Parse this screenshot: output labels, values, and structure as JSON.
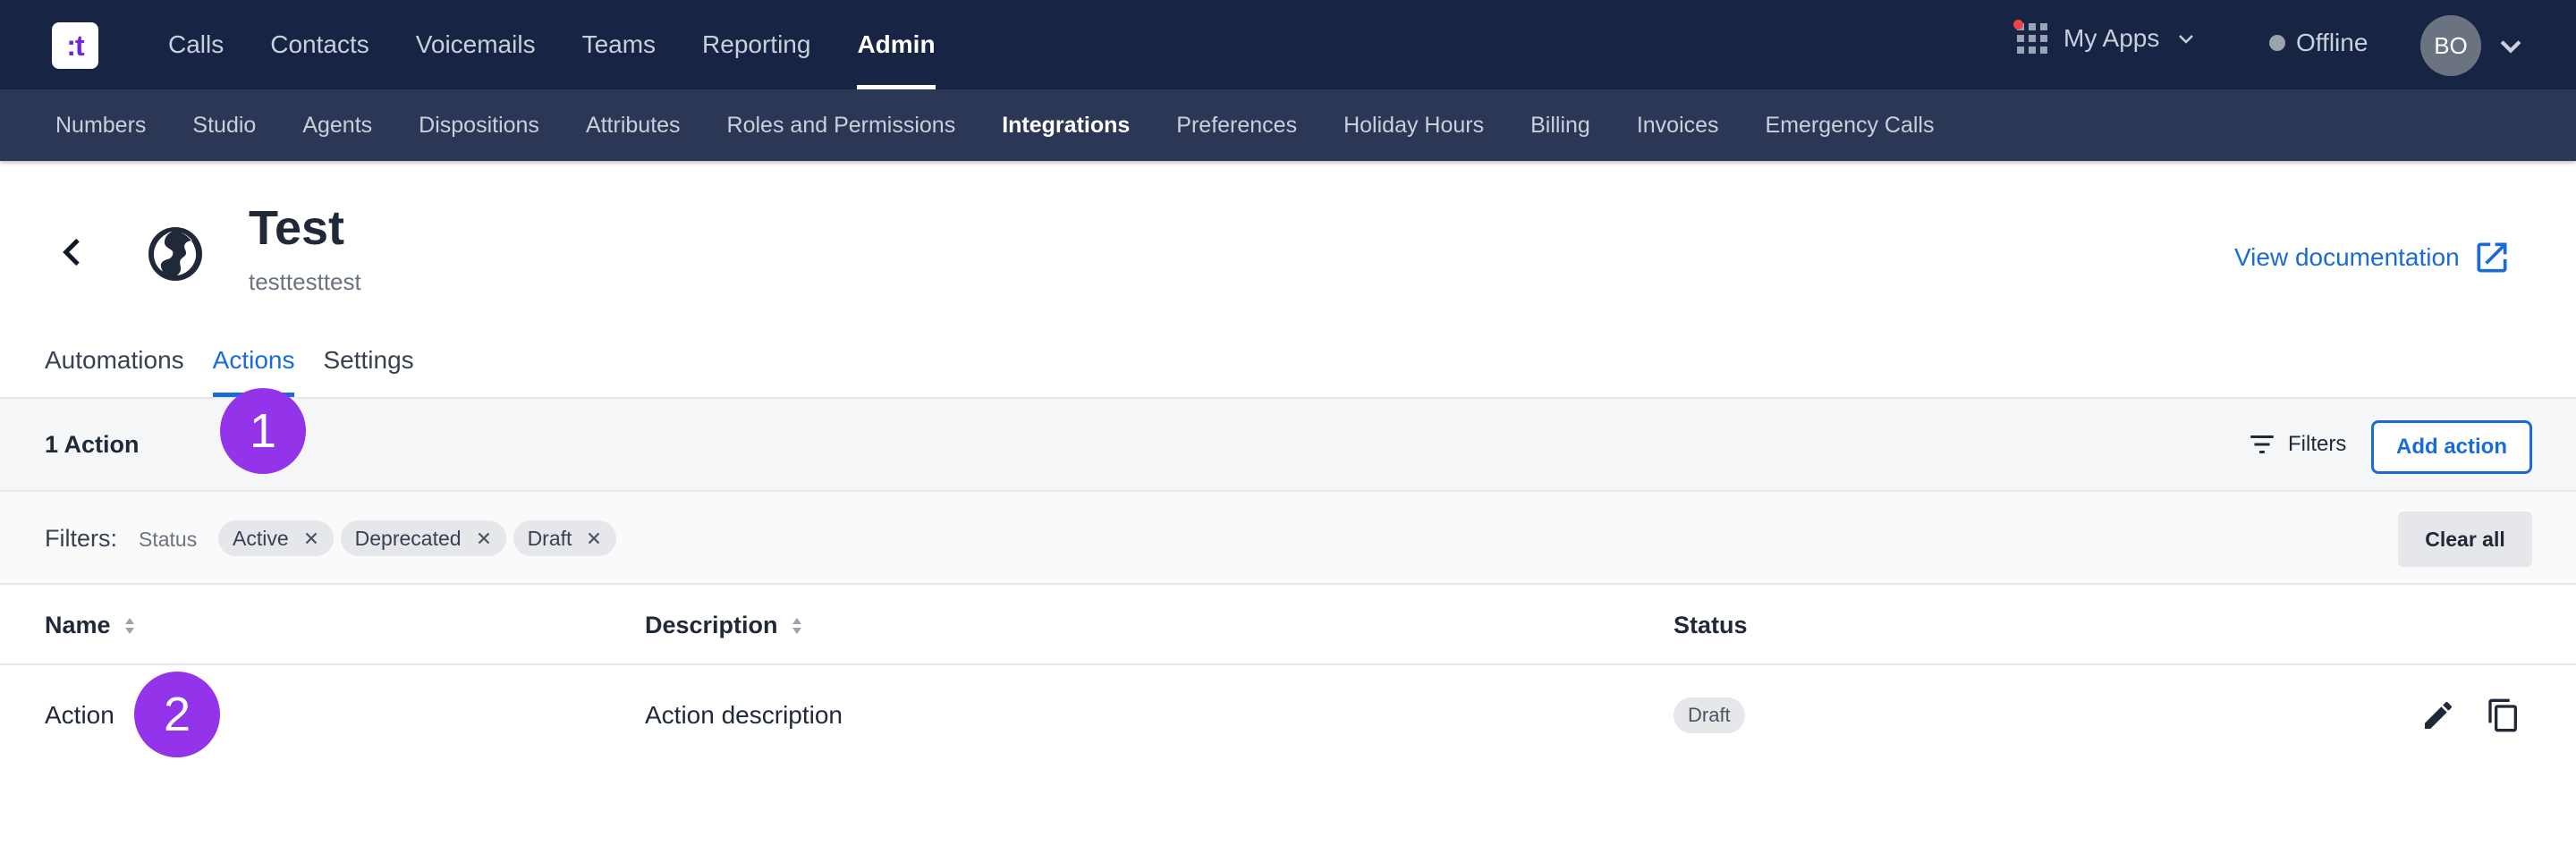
{
  "logo": {
    "text": ":t"
  },
  "nav": {
    "items": [
      {
        "label": "Calls"
      },
      {
        "label": "Contacts"
      },
      {
        "label": "Voicemails"
      },
      {
        "label": "Teams"
      },
      {
        "label": "Reporting"
      },
      {
        "label": "Admin",
        "active": true
      }
    ]
  },
  "user_area": {
    "apps_label": "My Apps",
    "status_label": "Offline",
    "avatar_initials": "BO"
  },
  "subnav": {
    "items": [
      {
        "label": "Numbers"
      },
      {
        "label": "Studio"
      },
      {
        "label": "Agents"
      },
      {
        "label": "Dispositions"
      },
      {
        "label": "Attributes"
      },
      {
        "label": "Roles and Permissions"
      },
      {
        "label": "Integrations",
        "active": true
      },
      {
        "label": "Preferences"
      },
      {
        "label": "Holiday Hours"
      },
      {
        "label": "Billing"
      },
      {
        "label": "Invoices"
      },
      {
        "label": "Emergency Calls"
      }
    ]
  },
  "header": {
    "title": "Test",
    "subtitle": "testtesttest",
    "docs_link": "View documentation"
  },
  "tabs": [
    {
      "label": "Automations"
    },
    {
      "label": "Actions",
      "active": true
    },
    {
      "label": "Settings"
    }
  ],
  "toolbar": {
    "count_label": "1 Action",
    "filters_label": "Filters",
    "add_label": "Add action"
  },
  "filters": {
    "label": "Filters:",
    "category": "Status",
    "chips": [
      "Active",
      "Deprecated",
      "Draft"
    ],
    "clear_label": "Clear all"
  },
  "table": {
    "columns": [
      "Name",
      "Description",
      "Status"
    ],
    "rows": [
      {
        "name": "Action",
        "description": "Action description",
        "status": "Draft"
      }
    ]
  },
  "markers": [
    "1",
    "2"
  ],
  "colors": {
    "topbar": "#182443",
    "subbar": "#2b3755",
    "accent": "#1a6bd6",
    "marker": "#9333ea"
  }
}
